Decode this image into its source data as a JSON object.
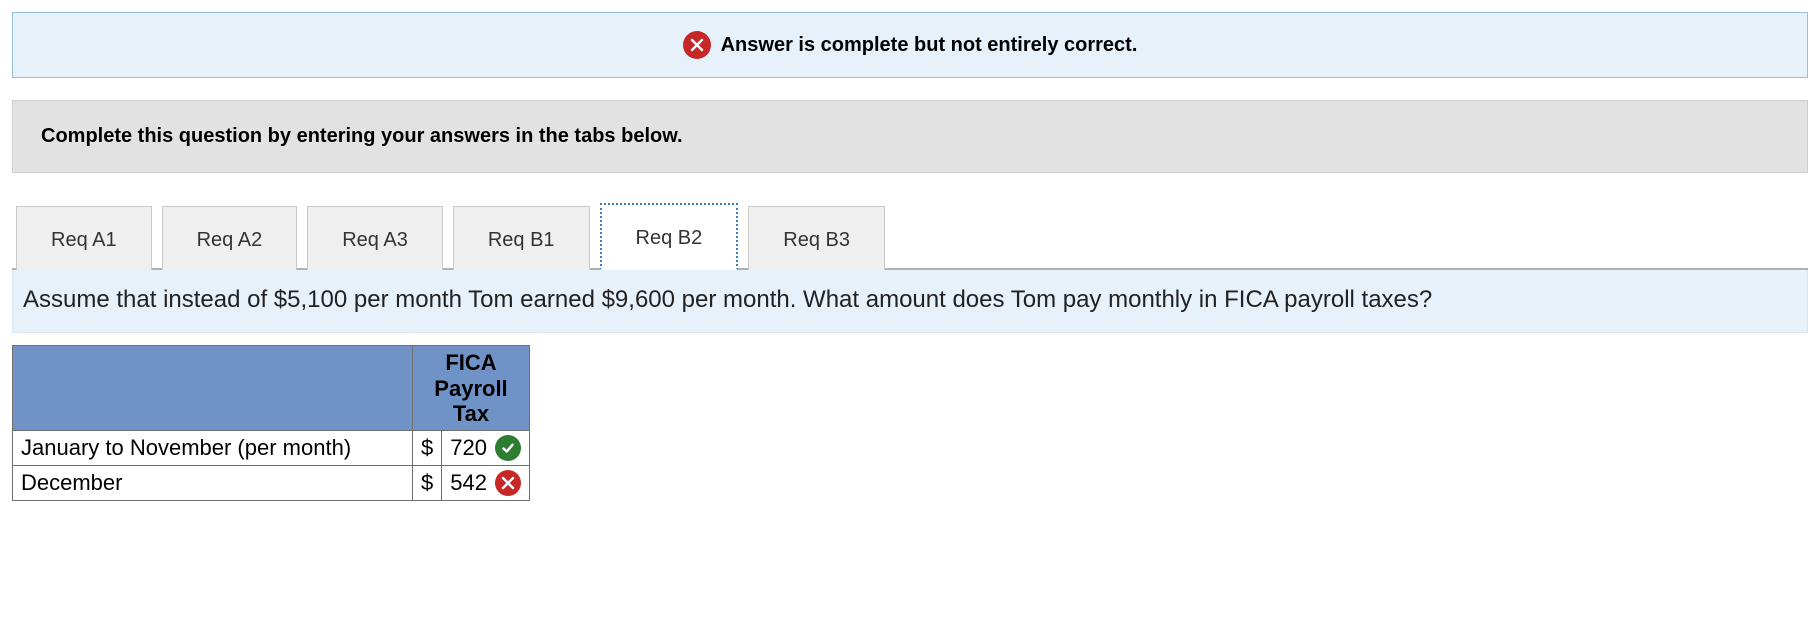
{
  "status_banner": {
    "text": "Answer is complete but not entirely correct."
  },
  "instruction": "Complete this question by entering your answers in the tabs below.",
  "tabs": [
    {
      "label": "Req A1",
      "active": false
    },
    {
      "label": "Req A2",
      "active": false
    },
    {
      "label": "Req A3",
      "active": false
    },
    {
      "label": "Req B1",
      "active": false
    },
    {
      "label": "Req B2",
      "active": true
    },
    {
      "label": "Req B3",
      "active": false
    }
  ],
  "prompt": "Assume that instead of $5,100 per month Tom earned $9,600 per month. What amount does Tom pay monthly in FICA payroll taxes?",
  "table": {
    "header_fica": "FICA\nPayroll\nTax",
    "rows": [
      {
        "label": "January to November (per month)",
        "currency": "$",
        "value": "720",
        "status": "correct"
      },
      {
        "label": "December",
        "currency": "$",
        "value": "542",
        "status": "incorrect"
      }
    ]
  }
}
